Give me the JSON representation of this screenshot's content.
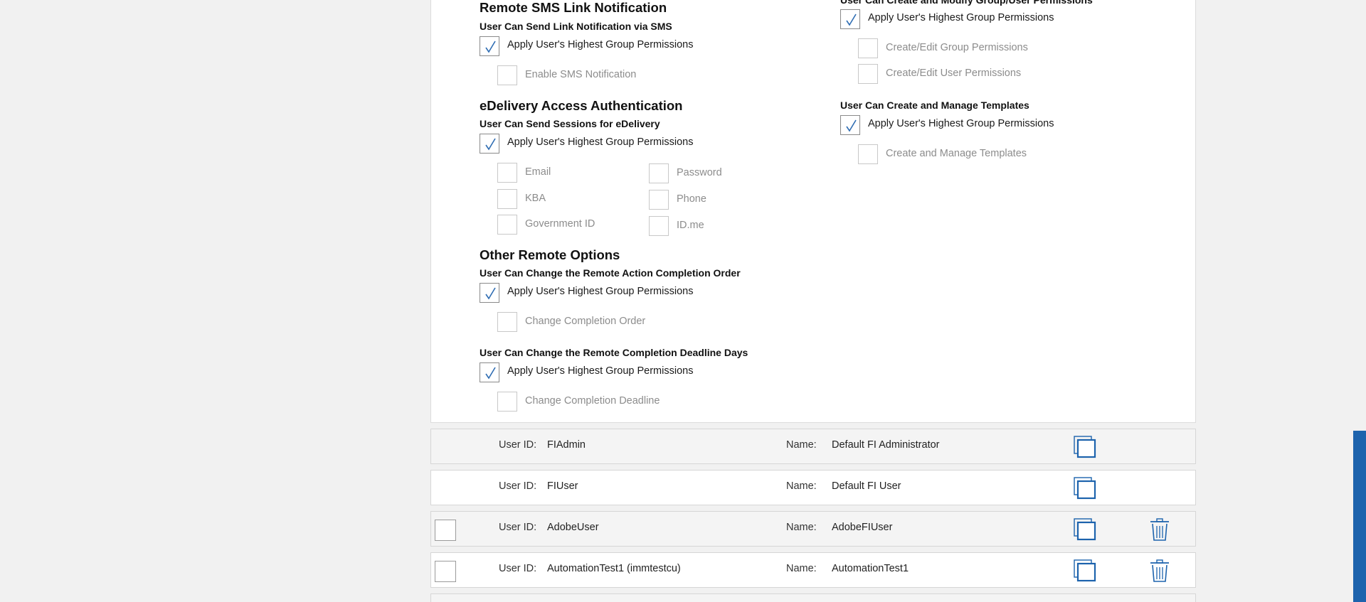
{
  "left_column": {
    "sms": {
      "heading": "Remote SMS Link Notification",
      "subheading": "User Can Send Link Notification via SMS",
      "apply_label": "Apply User's Highest Group Permissions",
      "option": "Enable SMS Notification"
    },
    "edelivery": {
      "heading": "eDelivery Access Authentication",
      "subheading": "User Can Send Sessions for eDelivery",
      "apply_label": "Apply User's Highest Group Permissions",
      "options_col1": [
        "Email",
        "KBA",
        "Government ID"
      ],
      "options_col2": [
        "Password",
        "Phone",
        "ID.me"
      ]
    },
    "other": {
      "heading": "Other Remote Options",
      "order_sub": "User Can Change the Remote Action Completion Order",
      "order_apply": "Apply User's Highest Group Permissions",
      "order_option": "Change Completion Order",
      "deadline_sub": "User Can Change the Remote Completion Deadline Days",
      "deadline_apply": "Apply User's Highest Group Permissions",
      "deadline_option": "Change Completion Deadline"
    }
  },
  "right_column": {
    "group_perm": {
      "subheading": "User Can Create and Modify Group/User Permissions",
      "apply_label": "Apply User's Highest Group Permissions",
      "option1": "Create/Edit Group Permissions",
      "option2": "Create/Edit User Permissions"
    },
    "templates": {
      "subheading": "User Can Create and Manage Templates",
      "apply_label": "Apply User's Highest Group Permissions",
      "option": "Create and Manage Templates"
    }
  },
  "users": {
    "userid_label": "User ID:",
    "name_label": "Name:",
    "rows": [
      {
        "user_id": "FIAdmin",
        "name": "Default FI Administrator"
      },
      {
        "user_id": "FIUser",
        "name": "Default FI User"
      },
      {
        "user_id": "AdobeUser",
        "name": "AdobeFIUser"
      },
      {
        "user_id": "AutomationTest1 (immtestcu)",
        "name": "AutomationTest1"
      }
    ]
  },
  "colors": {
    "accent": "#1d63ad",
    "check": "#2f6db3"
  },
  "icons": [
    "checkmark-icon",
    "copy-icon",
    "trash-icon"
  ]
}
